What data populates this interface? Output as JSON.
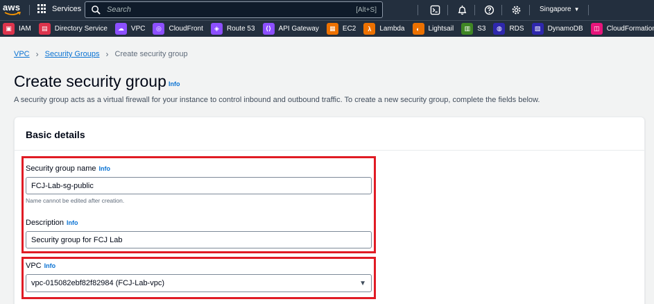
{
  "topnav": {
    "logo_text": "aws",
    "services_label": "Services",
    "search_placeholder": "Search",
    "search_shortcut": "[Alt+S]",
    "region_label": "Singapore"
  },
  "favorites": [
    {
      "label": "IAM",
      "color": "#dd344c",
      "icon": "iam-icon"
    },
    {
      "label": "Directory Service",
      "color": "#dd344c",
      "icon": "directory-service-icon"
    },
    {
      "label": "VPC",
      "color": "#8c4fff",
      "icon": "vpc-icon"
    },
    {
      "label": "CloudFront",
      "color": "#8c4fff",
      "icon": "cloudfront-icon"
    },
    {
      "label": "Route 53",
      "color": "#8c4fff",
      "icon": "route53-icon"
    },
    {
      "label": "API Gateway",
      "color": "#8c4fff",
      "icon": "api-gateway-icon"
    },
    {
      "label": "EC2",
      "color": "#ed7100",
      "icon": "ec2-icon"
    },
    {
      "label": "Lambda",
      "color": "#ed7100",
      "icon": "lambda-icon"
    },
    {
      "label": "Lightsail",
      "color": "#ed7100",
      "icon": "lightsail-icon"
    },
    {
      "label": "S3",
      "color": "#3f8624",
      "icon": "s3-icon"
    },
    {
      "label": "RDS",
      "color": "#2e27ad",
      "icon": "rds-icon"
    },
    {
      "label": "DynamoDB",
      "color": "#2e27ad",
      "icon": "dynamodb-icon"
    },
    {
      "label": "CloudFormation",
      "color": "#e7157b",
      "icon": "cloudformation-icon"
    }
  ],
  "breadcrumb": {
    "vpc": "VPC",
    "security_groups": "Security Groups",
    "current": "Create security group"
  },
  "header": {
    "title": "Create security group",
    "info": "Info",
    "description": "A security group acts as a virtual firewall for your instance to control inbound and outbound traffic. To create a new security group, complete the fields below."
  },
  "basic_details": {
    "title": "Basic details",
    "name_label": "Security group name",
    "name_info": "Info",
    "name_value": "FCJ-Lab-sg-public",
    "name_constraint": "Name cannot be edited after creation.",
    "description_label": "Description",
    "description_info": "Info",
    "description_value": "Security group for FCJ Lab",
    "vpc_label": "VPC",
    "vpc_info": "Info",
    "vpc_value": "vpc-015082ebf82f82984 (FCJ-Lab-vpc)"
  },
  "colors": {
    "nav_bg": "#232f3e",
    "link": "#0972d3",
    "highlight": "#e01b24"
  }
}
